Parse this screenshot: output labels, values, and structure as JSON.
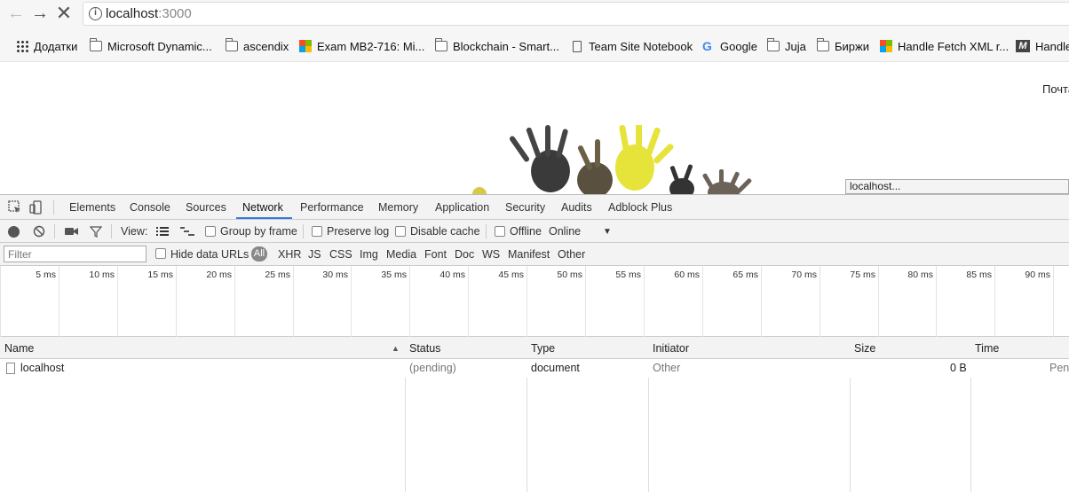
{
  "browser": {
    "url_host": "localhost",
    "url_port": ":3000"
  },
  "bookmarks": [
    {
      "label": "Додатки",
      "icon": "apps-grid-icon"
    },
    {
      "label": "Microsoft Dynamic...",
      "icon": "folder-icon"
    },
    {
      "label": "ascendix",
      "icon": "folder-icon"
    },
    {
      "label": "Exam MB2-716: Mi...",
      "icon": "microsoft-icon"
    },
    {
      "label": "Blockchain - Smart...",
      "icon": "folder-icon"
    },
    {
      "label": "Team Site Notebook",
      "icon": "page-icon"
    },
    {
      "label": "Google",
      "icon": "google-icon"
    },
    {
      "label": "Juja",
      "icon": "folder-icon"
    },
    {
      "label": "Биржи",
      "icon": "folder-icon"
    },
    {
      "label": "Handle Fetch XML r...",
      "icon": "microsoft-icon"
    },
    {
      "label": "Handle",
      "icon": "m-icon"
    }
  ],
  "page": {
    "mail_link": "Почта",
    "status_bubble": "localhost..."
  },
  "devtools": {
    "tabs": [
      "Elements",
      "Console",
      "Sources",
      "Network",
      "Performance",
      "Memory",
      "Application",
      "Security",
      "Audits",
      "Adblock Plus"
    ],
    "active_tab": "Network",
    "toolbar": {
      "view_label": "View:",
      "group_by_frame": "Group by frame",
      "preserve_log": "Preserve log",
      "disable_cache": "Disable cache",
      "offline": "Offline",
      "throttle": "Online"
    },
    "filter": {
      "placeholder": "Filter",
      "hide_data_urls": "Hide data URLs",
      "all": "All",
      "types": [
        "XHR",
        "JS",
        "CSS",
        "Img",
        "Media",
        "Font",
        "Doc",
        "WS",
        "Manifest",
        "Other"
      ]
    },
    "timeline_ticks": [
      "5 ms",
      "10 ms",
      "15 ms",
      "20 ms",
      "25 ms",
      "30 ms",
      "35 ms",
      "40 ms",
      "45 ms",
      "50 ms",
      "55 ms",
      "60 ms",
      "65 ms",
      "70 ms",
      "75 ms",
      "80 ms",
      "85 ms",
      "90 ms"
    ],
    "columns": [
      "Name",
      "Status",
      "Type",
      "Initiator",
      "Size",
      "Time"
    ],
    "rows": [
      {
        "name": "localhost",
        "status": "(pending)",
        "type": "document",
        "initiator": "Other",
        "size": "0 B",
        "time": "Pen"
      }
    ]
  }
}
